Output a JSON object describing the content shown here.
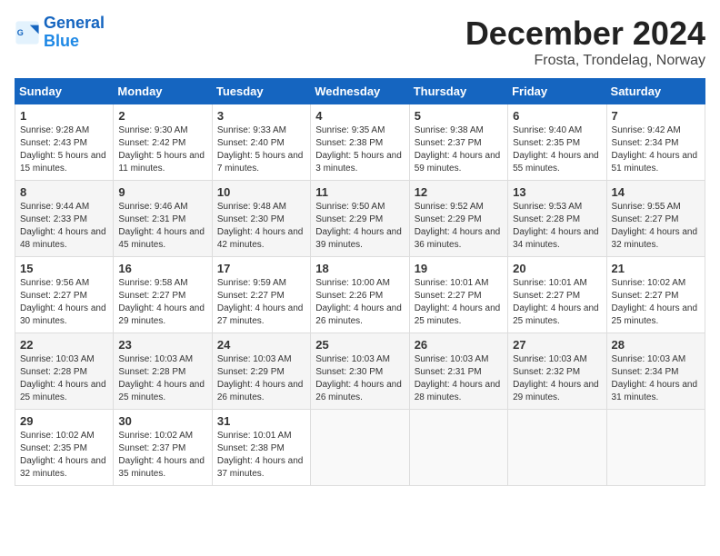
{
  "header": {
    "logo_line1": "General",
    "logo_line2": "Blue",
    "title": "December 2024",
    "subtitle": "Frosta, Trondelag, Norway"
  },
  "calendar": {
    "days_of_week": [
      "Sunday",
      "Monday",
      "Tuesday",
      "Wednesday",
      "Thursday",
      "Friday",
      "Saturday"
    ],
    "weeks": [
      [
        {
          "day": "1",
          "sunrise": "9:28 AM",
          "sunset": "2:43 PM",
          "daylight": "5 hours and 15 minutes."
        },
        {
          "day": "2",
          "sunrise": "9:30 AM",
          "sunset": "2:42 PM",
          "daylight": "5 hours and 11 minutes."
        },
        {
          "day": "3",
          "sunrise": "9:33 AM",
          "sunset": "2:40 PM",
          "daylight": "5 hours and 7 minutes."
        },
        {
          "day": "4",
          "sunrise": "9:35 AM",
          "sunset": "2:38 PM",
          "daylight": "5 hours and 3 minutes."
        },
        {
          "day": "5",
          "sunrise": "9:38 AM",
          "sunset": "2:37 PM",
          "daylight": "4 hours and 59 minutes."
        },
        {
          "day": "6",
          "sunrise": "9:40 AM",
          "sunset": "2:35 PM",
          "daylight": "4 hours and 55 minutes."
        },
        {
          "day": "7",
          "sunrise": "9:42 AM",
          "sunset": "2:34 PM",
          "daylight": "4 hours and 51 minutes."
        }
      ],
      [
        {
          "day": "8",
          "sunrise": "9:44 AM",
          "sunset": "2:33 PM",
          "daylight": "4 hours and 48 minutes."
        },
        {
          "day": "9",
          "sunrise": "9:46 AM",
          "sunset": "2:31 PM",
          "daylight": "4 hours and 45 minutes."
        },
        {
          "day": "10",
          "sunrise": "9:48 AM",
          "sunset": "2:30 PM",
          "daylight": "4 hours and 42 minutes."
        },
        {
          "day": "11",
          "sunrise": "9:50 AM",
          "sunset": "2:29 PM",
          "daylight": "4 hours and 39 minutes."
        },
        {
          "day": "12",
          "sunrise": "9:52 AM",
          "sunset": "2:29 PM",
          "daylight": "4 hours and 36 minutes."
        },
        {
          "day": "13",
          "sunrise": "9:53 AM",
          "sunset": "2:28 PM",
          "daylight": "4 hours and 34 minutes."
        },
        {
          "day": "14",
          "sunrise": "9:55 AM",
          "sunset": "2:27 PM",
          "daylight": "4 hours and 32 minutes."
        }
      ],
      [
        {
          "day": "15",
          "sunrise": "9:56 AM",
          "sunset": "2:27 PM",
          "daylight": "4 hours and 30 minutes."
        },
        {
          "day": "16",
          "sunrise": "9:58 AM",
          "sunset": "2:27 PM",
          "daylight": "4 hours and 29 minutes."
        },
        {
          "day": "17",
          "sunrise": "9:59 AM",
          "sunset": "2:27 PM",
          "daylight": "4 hours and 27 minutes."
        },
        {
          "day": "18",
          "sunrise": "10:00 AM",
          "sunset": "2:26 PM",
          "daylight": "4 hours and 26 minutes."
        },
        {
          "day": "19",
          "sunrise": "10:01 AM",
          "sunset": "2:27 PM",
          "daylight": "4 hours and 25 minutes."
        },
        {
          "day": "20",
          "sunrise": "10:01 AM",
          "sunset": "2:27 PM",
          "daylight": "4 hours and 25 minutes."
        },
        {
          "day": "21",
          "sunrise": "10:02 AM",
          "sunset": "2:27 PM",
          "daylight": "4 hours and 25 minutes."
        }
      ],
      [
        {
          "day": "22",
          "sunrise": "10:03 AM",
          "sunset": "2:28 PM",
          "daylight": "4 hours and 25 minutes."
        },
        {
          "day": "23",
          "sunrise": "10:03 AM",
          "sunset": "2:28 PM",
          "daylight": "4 hours and 25 minutes."
        },
        {
          "day": "24",
          "sunrise": "10:03 AM",
          "sunset": "2:29 PM",
          "daylight": "4 hours and 26 minutes."
        },
        {
          "day": "25",
          "sunrise": "10:03 AM",
          "sunset": "2:30 PM",
          "daylight": "4 hours and 26 minutes."
        },
        {
          "day": "26",
          "sunrise": "10:03 AM",
          "sunset": "2:31 PM",
          "daylight": "4 hours and 28 minutes."
        },
        {
          "day": "27",
          "sunrise": "10:03 AM",
          "sunset": "2:32 PM",
          "daylight": "4 hours and 29 minutes."
        },
        {
          "day": "28",
          "sunrise": "10:03 AM",
          "sunset": "2:34 PM",
          "daylight": "4 hours and 31 minutes."
        }
      ],
      [
        {
          "day": "29",
          "sunrise": "10:02 AM",
          "sunset": "2:35 PM",
          "daylight": "4 hours and 32 minutes."
        },
        {
          "day": "30",
          "sunrise": "10:02 AM",
          "sunset": "2:37 PM",
          "daylight": "4 hours and 35 minutes."
        },
        {
          "day": "31",
          "sunrise": "10:01 AM",
          "sunset": "2:38 PM",
          "daylight": "4 hours and 37 minutes."
        },
        null,
        null,
        null,
        null
      ]
    ]
  }
}
